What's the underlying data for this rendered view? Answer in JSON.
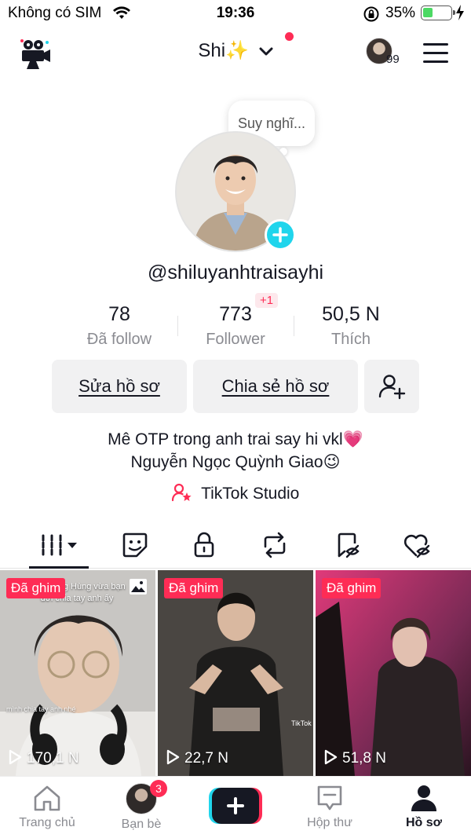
{
  "status_bar": {
    "carrier": "Không có SIM",
    "time": "19:36",
    "battery_percent": "35%",
    "battery_level": 0.35
  },
  "header": {
    "profile_name": "Shi✨",
    "notification_count": "99"
  },
  "profile": {
    "thought_bubble": "Suy nghĩ...",
    "username": "@shiluyanhtraisayhi",
    "stats": [
      {
        "value": "78",
        "label": "Đã follow"
      },
      {
        "value": "773",
        "label": "Follower"
      },
      {
        "value": "50,5 N",
        "label": "Thích"
      }
    ],
    "follower_delta": "+1",
    "buttons": {
      "edit": "Sửa hồ sơ",
      "share": "Chia sẻ hồ sơ"
    },
    "bio_line1": "Mê OTP trong anh trai say hi vkl💗",
    "bio_line2": "Nguyễn Ngọc Quỳnh Giao😉",
    "studio_link": "TikTok Studio"
  },
  "videos": [
    {
      "pinned_label": "Đã ghim",
      "views": "170,1 N",
      "overlay_text": "gái Quang Hùng vừa bạn đời chia tay anh ấy",
      "caption_strip": "mình chia tay anh nhé"
    },
    {
      "pinned_label": "Đã ghim",
      "views": "22,7 N",
      "watermark": "TikTok"
    },
    {
      "pinned_label": "Đã ghim",
      "views": "51,8 N"
    }
  ],
  "bottom_nav": {
    "home": "Trang chủ",
    "friends": "Bạn bè",
    "friends_badge": "3",
    "inbox": "Hộp thư",
    "profile": "Hồ sơ"
  },
  "colors": {
    "accent": "#fe2c55",
    "cyan": "#20d5ec",
    "text": "#161823",
    "muted": "#8a8b91",
    "button_bg": "#f1f1f2"
  }
}
